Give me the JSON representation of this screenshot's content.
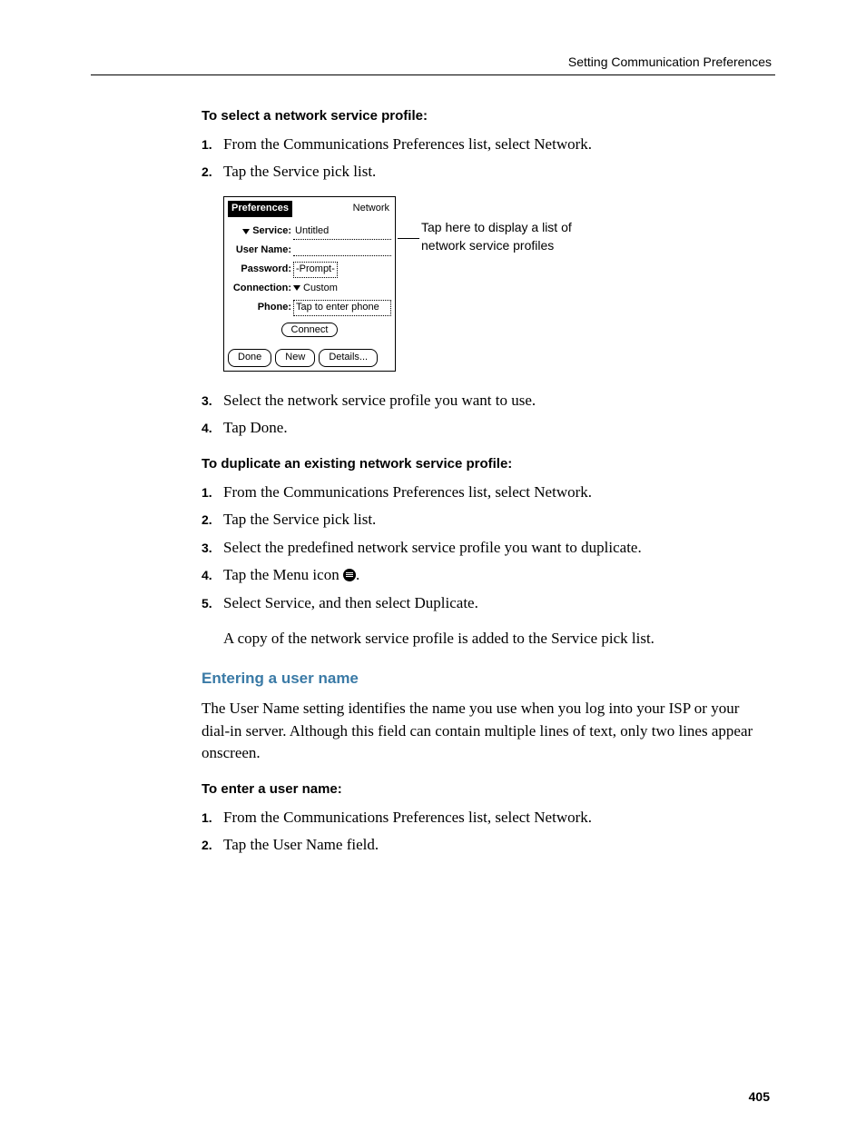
{
  "running_head": "Setting Communication Preferences",
  "page_number": "405",
  "section1": {
    "heading": "To select a network service profile:",
    "steps": [
      "From the Communications Preferences list, select Network.",
      "Tap the Service pick list."
    ],
    "steps_after": [
      "Select the network service profile you want to use.",
      "Tap Done."
    ]
  },
  "device": {
    "title_left": "Preferences",
    "title_right": "Network",
    "service_label": "Service:",
    "service_value": "Untitled",
    "user_label": "User Name:",
    "user_value": "",
    "password_label": "Password:",
    "password_value": "-Prompt-",
    "connection_label": "Connection:",
    "connection_value": "Custom",
    "phone_label": "Phone:",
    "phone_value": "Tap to enter phone",
    "connect_btn": "Connect",
    "done_btn": "Done",
    "new_btn": "New",
    "details_btn": "Details..."
  },
  "callout": "Tap here to display a list of network service profiles",
  "section2": {
    "heading": "To duplicate an existing network service profile:",
    "steps": [
      "From the Communications Preferences list, select Network.",
      "Tap the Service pick list.",
      "Select the predefined network service profile you want to duplicate.",
      "Tap the Menu icon",
      "Select Service, and then select Duplicate."
    ],
    "result": "A copy of the network service profile is added to the Service pick list."
  },
  "section3": {
    "heading": "Entering a user name",
    "body": "The User Name setting identifies the name you use when you log into your ISP or your dial-in server. Although this field can contain multiple lines of text, only two lines appear onscreen.",
    "sub": "To enter a user name:",
    "steps": [
      "From the Communications Preferences list, select Network.",
      "Tap the User Name field."
    ]
  }
}
